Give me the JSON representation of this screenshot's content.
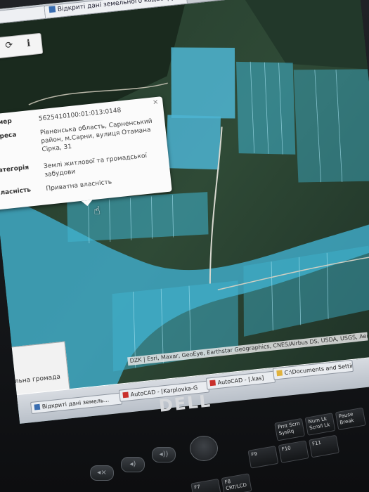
{
  "browser": {
    "tabs": [
      {
        "label": ""
      },
      {
        "label": "Відкриті дані земельного кадастру України"
      }
    ]
  },
  "toolbar": {
    "buttons": [
      {
        "icon": "warning-icon",
        "glyph": "⚠"
      },
      {
        "icon": "refresh-icon",
        "glyph": "⟳"
      },
      {
        "icon": "info-icon",
        "glyph": "ℹ"
      }
    ]
  },
  "popup": {
    "close": "×",
    "fields": [
      {
        "label": "Номер",
        "value": "5625410100:01:013:0148"
      },
      {
        "label": "Адреса",
        "value": "Рівненська область, Сарненський район, м.Сарни, вулиця Отамана Сірка, 31"
      },
      {
        "label": "Категорія",
        "value": "Землі житлової та громадської забудови"
      },
      {
        "label": "Власність",
        "value": "Приватна власність"
      }
    ]
  },
  "map": {
    "attribution": "DZK | Esri, Maxar, GeoEye, Earthstar Geographics, CNES/Airbus DS, USDA, USGS, AeroGRID, IGN"
  },
  "side_panel": {
    "text": "льна громада"
  },
  "taskbar": {
    "items": [
      {
        "label": "Відкриті дані земель..."
      },
      {
        "label": "AutoCAD - [Karplovka-G"
      },
      {
        "label": "AutoCAD - [.kas]"
      },
      {
        "label": "C:\\Documents and Settin"
      }
    ]
  },
  "laptop": {
    "brand": "DELL",
    "keys": [
      {
        "top": "Prnt Scrn",
        "bottom": "SysRq"
      },
      {
        "top": "Num Lk",
        "bottom": "Scroll Lk"
      },
      {
        "top": "Pause",
        "bottom": "Break"
      },
      {
        "top": "F9",
        "bottom": ""
      },
      {
        "top": "F10",
        "bottom": ""
      },
      {
        "top": "F11",
        "bottom": ""
      },
      {
        "top": "F7",
        "bottom": ""
      },
      {
        "top": "F8",
        "bottom": "CRT/LCD"
      }
    ]
  },
  "colors": {
    "parcel_fill": "#3fb4cf",
    "popup_bg": "#fbfbfb",
    "taskbar": "#c8ced6"
  }
}
